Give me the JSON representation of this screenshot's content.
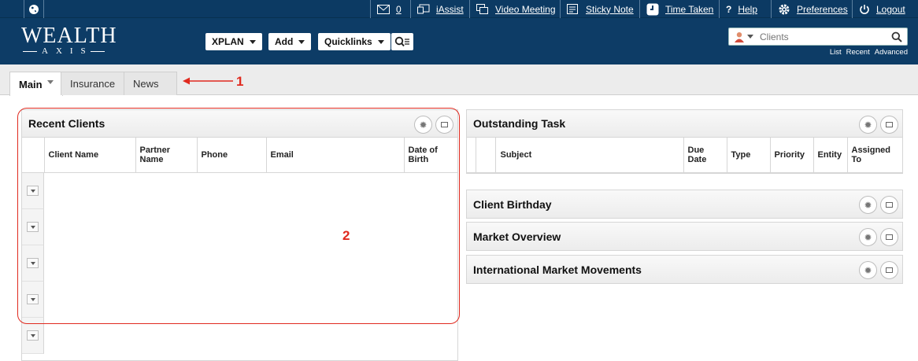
{
  "topbar": {
    "messages_count": "0",
    "iassist": "iAssist",
    "video_meeting": "Video Meeting",
    "sticky_note": "Sticky Note",
    "time_taken": "Time Taken",
    "help_symbol": "?",
    "help": "Help",
    "preferences": "Preferences",
    "logout": "Logout",
    "icons": [
      "globe-icon",
      "envelope-icon",
      "iassist-icon",
      "video-icon",
      "sticky-note-icon",
      "clock-icon",
      "gear-icon",
      "power-icon"
    ]
  },
  "brand": {
    "line1": "WEALTH",
    "line2": "AXIS"
  },
  "nav": {
    "xplan": "XPLAN",
    "add": "Add",
    "quicklinks": "Quicklinks"
  },
  "search": {
    "placeholder": "Clients",
    "links": [
      "List",
      "Recent",
      "Advanced"
    ]
  },
  "tabs": [
    {
      "label": "Main",
      "active": true
    },
    {
      "label": "Insurance",
      "active": false
    },
    {
      "label": "News",
      "active": false
    }
  ],
  "recent_clients": {
    "title": "Recent Clients",
    "columns": [
      "Client Name",
      "Partner Name",
      "Phone",
      "Email",
      "Date of Birth"
    ],
    "row_count": 5
  },
  "outstanding_task": {
    "title": "Outstanding Task",
    "columns": [
      "Subject",
      "Due Date",
      "Type",
      "Priority",
      "Entity",
      "Assigned To"
    ]
  },
  "widgets": [
    "Client Birthday",
    "Market Overview",
    "International Market Movements"
  ],
  "annotations": {
    "one": "1",
    "two": "2"
  },
  "colors": {
    "header": "#0d3c66",
    "annotation": "#e02a1f"
  }
}
